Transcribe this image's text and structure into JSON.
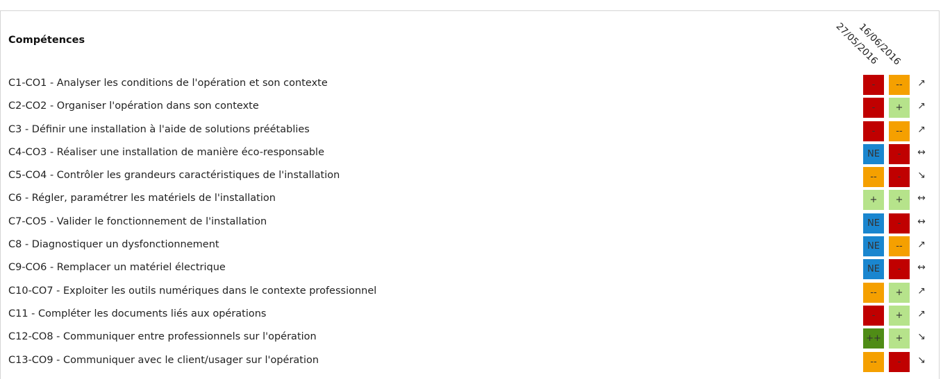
{
  "header": {
    "title": "Compétences",
    "dates": [
      "27/05/2016",
      "16/06/2016"
    ]
  },
  "colors": {
    "-": "#c00000",
    "--": "#f5a000",
    "+": "#b6e38b",
    "++": "#4f8c16",
    "NE": "#1a86cf"
  },
  "icons": {
    "up": "trend-up-icon",
    "down": "trend-down-icon",
    "same": "trend-stable-icon"
  },
  "competences": [
    {
      "label": "C1-CO1 - Analyser les conditions de l'opération et son contexte",
      "ratings": [
        "-",
        "--"
      ],
      "trend": "↗"
    },
    {
      "label": "C2-CO2 - Organiser l'opération dans son contexte",
      "ratings": [
        "-",
        "+"
      ],
      "trend": "↗"
    },
    {
      "label": "C3 - Définir une installation à l'aide de solutions préétablies",
      "ratings": [
        "-",
        "--"
      ],
      "trend": "↗"
    },
    {
      "label": "C4-CO3 - Réaliser une installation de manière éco-responsable",
      "ratings": [
        "NE",
        "-"
      ],
      "trend": "↔"
    },
    {
      "label": "C5-CO4 - Contrôler les grandeurs caractéristiques de l'installation",
      "ratings": [
        "--",
        "-"
      ],
      "trend": "↘"
    },
    {
      "label": "C6 - Régler, paramétrer les matériels de l'installation",
      "ratings": [
        "+",
        "+"
      ],
      "trend": "↔"
    },
    {
      "label": "C7-CO5 - Valider le fonctionnement de l'installation",
      "ratings": [
        "NE",
        "-"
      ],
      "trend": "↔"
    },
    {
      "label": "C8 - Diagnostiquer un dysfonctionnement",
      "ratings": [
        "NE",
        "--"
      ],
      "trend": "↗"
    },
    {
      "label": "C9-CO6 - Remplacer un matériel électrique",
      "ratings": [
        "NE",
        "-"
      ],
      "trend": "↔"
    },
    {
      "label": "C10-CO7 - Exploiter les outils numériques dans le contexte professionnel",
      "ratings": [
        "--",
        "+"
      ],
      "trend": "↗"
    },
    {
      "label": "C11 - Compléter les documents liés aux opérations",
      "ratings": [
        "-",
        "+"
      ],
      "trend": "↗"
    },
    {
      "label": "C12-CO8 - Communiquer entre professionnels sur l'opération",
      "ratings": [
        "++",
        "+"
      ],
      "trend": "↘"
    },
    {
      "label": "C13-CO9 - Communiquer avec le client/usager sur l'opération",
      "ratings": [
        "--",
        "-"
      ],
      "trend": "↘"
    }
  ]
}
